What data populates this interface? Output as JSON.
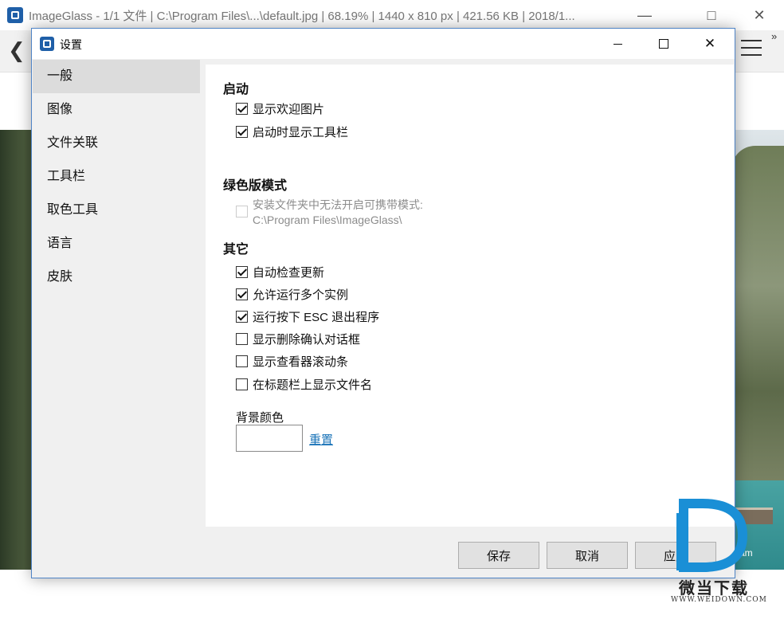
{
  "background_window": {
    "title": "ImageGlass - 1/1 文件  |  C:\\Program Files\\...\\default.jpg  |  68.19%  |  1440 x 810 px  |  421.56 KB  |  2018/1...",
    "photo_caption": "tnam",
    "icons": [
      "app-icon",
      "minimize-icon",
      "maximize-icon",
      "close-icon",
      "back-arrow-icon",
      "hamburger-menu-icon",
      "more-chevron-icon"
    ]
  },
  "dialog": {
    "title": "设置",
    "icons": [
      "app-icon",
      "minimize-icon",
      "maximize-icon",
      "close-icon"
    ]
  },
  "nav": {
    "items": [
      {
        "label": "一般",
        "active": true
      },
      {
        "label": "图像",
        "active": false
      },
      {
        "label": "文件关联",
        "active": false
      },
      {
        "label": "工具栏",
        "active": false
      },
      {
        "label": "取色工具",
        "active": false
      },
      {
        "label": "语言",
        "active": false
      },
      {
        "label": "皮肤",
        "active": false
      }
    ]
  },
  "general": {
    "startup": {
      "heading": "启动",
      "show_welcome": {
        "label": "显示欢迎图片",
        "checked": true
      },
      "show_toolbar": {
        "label": "启动时显示工具栏",
        "checked": true
      }
    },
    "portable": {
      "heading": "绿色版模式",
      "option": {
        "label_line1": "安装文件夹中无法开启可携带模式:",
        "label_line2": "C:\\Program Files\\ImageGlass\\",
        "checked": false,
        "disabled": true
      }
    },
    "other": {
      "heading": "其它",
      "auto_update": {
        "label": "自动检查更新",
        "checked": true
      },
      "multi_instance": {
        "label": "允许运行多个实例",
        "checked": true
      },
      "esc_exit": {
        "label": "运行按下 ESC 退出程序",
        "checked": true
      },
      "confirm_delete": {
        "label": "显示删除确认对话框",
        "checked": false
      },
      "show_scrollbar": {
        "label": "显示查看器滚动条",
        "checked": false
      },
      "filename_titlebar": {
        "label": "在标题栏上显示文件名",
        "checked": false
      }
    },
    "background_color": {
      "label": "背景颜色",
      "value": "#ffffff",
      "reset_label": "重置"
    }
  },
  "buttons": {
    "save": "保存",
    "cancel": "取消",
    "apply": "应用"
  },
  "watermark": {
    "text": "微当下载",
    "url": "WWW.WEIDOWN.COM"
  },
  "colors": {
    "accent_border": "#4f84c6",
    "link": "#1a73b8",
    "nav_active": "#dcdcdc",
    "dialog_bg": "#f0f0f0"
  }
}
